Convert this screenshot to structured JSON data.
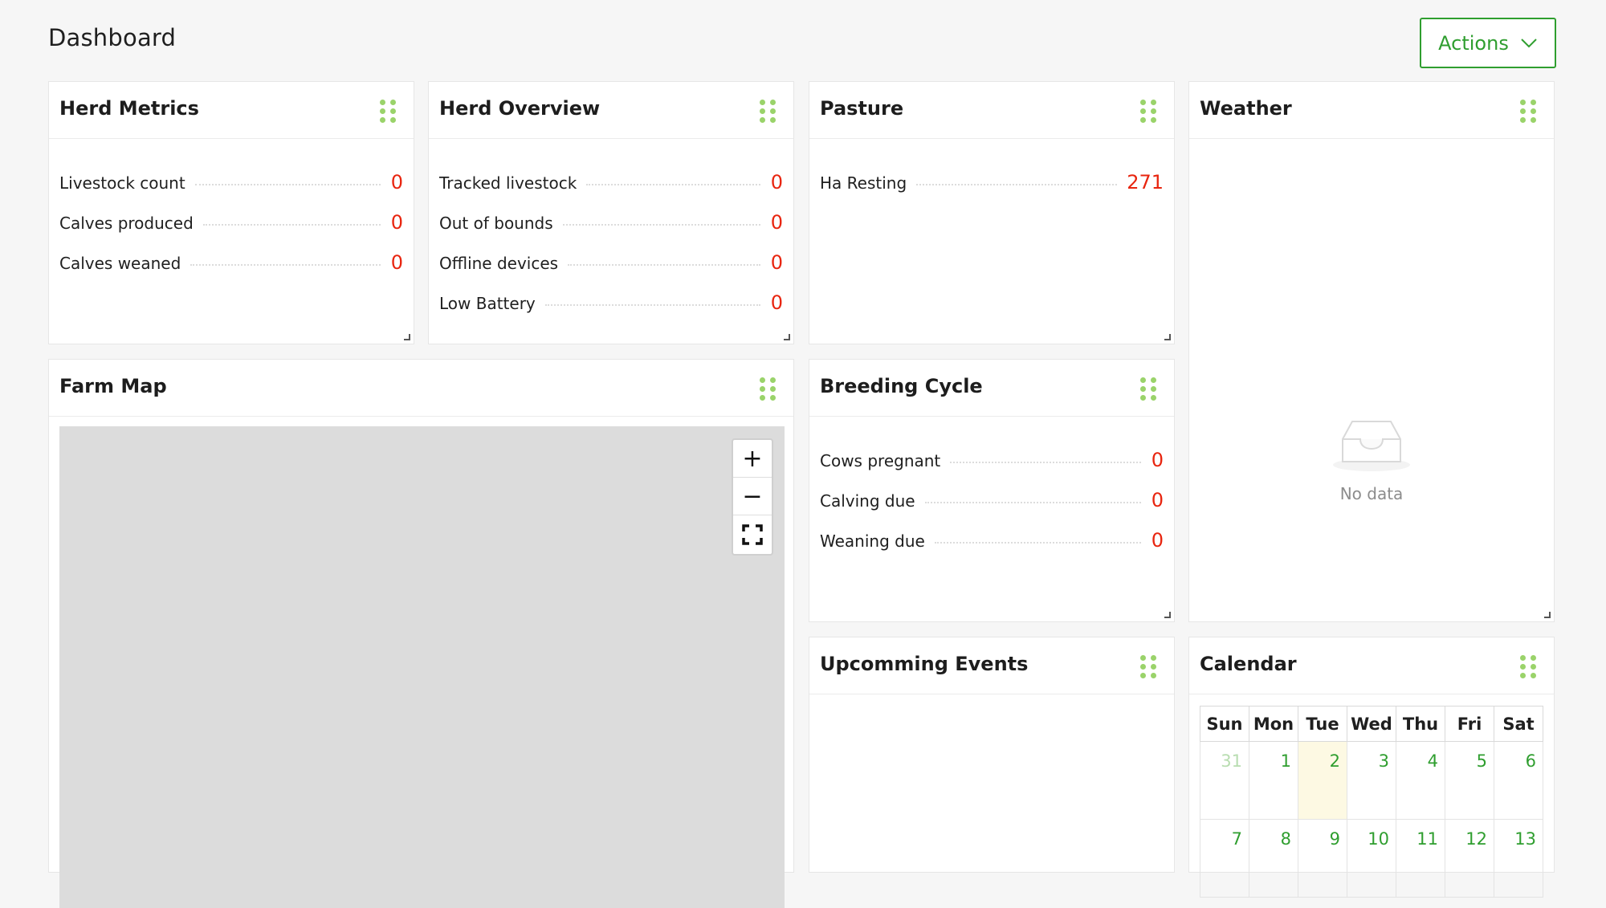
{
  "page": {
    "title": "Dashboard",
    "actions_label": "Actions"
  },
  "colors": {
    "accent": "#2f9e2f",
    "value_red": "#e8250f",
    "handle_green": "#9ad36a",
    "map_gray": "#dcdcdc",
    "today_highlight": "#fdf9e3"
  },
  "herd_metrics": {
    "title": "Herd Metrics",
    "rows": [
      {
        "label": "Livestock count",
        "value": "0"
      },
      {
        "label": "Calves produced",
        "value": "0"
      },
      {
        "label": "Calves weaned",
        "value": "0"
      }
    ]
  },
  "herd_overview": {
    "title": "Herd Overview",
    "rows": [
      {
        "label": "Tracked livestock",
        "value": "0"
      },
      {
        "label": "Out of bounds",
        "value": "0"
      },
      {
        "label": "Offline devices",
        "value": "0"
      },
      {
        "label": "Low Battery",
        "value": "0"
      }
    ]
  },
  "pasture": {
    "title": "Pasture",
    "rows": [
      {
        "label": "Ha Resting",
        "value": "271"
      }
    ]
  },
  "weather": {
    "title": "Weather",
    "empty_text": "No data",
    "empty_icon": "empty-inbox-icon"
  },
  "farm_map": {
    "title": "Farm Map",
    "controls": [
      {
        "name": "zoom-in-button",
        "symbol": "+"
      },
      {
        "name": "zoom-out-button",
        "symbol": "−"
      },
      {
        "name": "fullscreen-button",
        "icon": "fullscreen-icon"
      }
    ]
  },
  "breeding_cycle": {
    "title": "Breeding Cycle",
    "rows": [
      {
        "label": "Cows pregnant",
        "value": "0"
      },
      {
        "label": "Calving due",
        "value": "0"
      },
      {
        "label": "Weaning due",
        "value": "0"
      }
    ]
  },
  "upcoming_events": {
    "title": "Upcomming Events"
  },
  "calendar": {
    "title": "Calendar",
    "weekdays": [
      "Sun",
      "Mon",
      "Tue",
      "Wed",
      "Thu",
      "Fri",
      "Sat"
    ],
    "weeks": [
      [
        {
          "day": "31",
          "muted": true
        },
        {
          "day": "1"
        },
        {
          "day": "2",
          "today": true
        },
        {
          "day": "3"
        },
        {
          "day": "4"
        },
        {
          "day": "5"
        },
        {
          "day": "6"
        }
      ],
      [
        {
          "day": "7"
        },
        {
          "day": "8"
        },
        {
          "day": "9"
        },
        {
          "day": "10"
        },
        {
          "day": "11"
        },
        {
          "day": "12"
        },
        {
          "day": "13"
        }
      ]
    ]
  }
}
